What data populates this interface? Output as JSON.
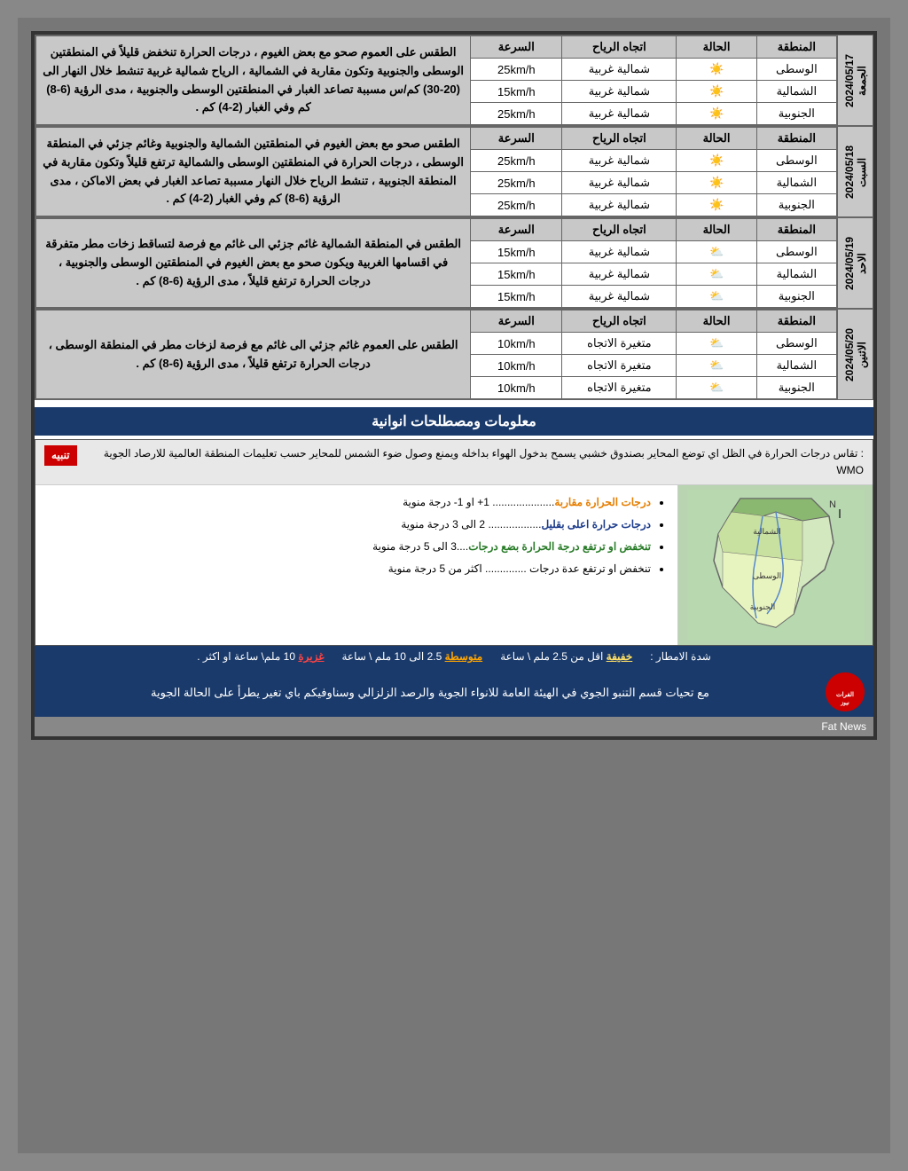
{
  "page": {
    "background": "#777",
    "border_color": "#333"
  },
  "days": [
    {
      "id": "friday",
      "label": "الجمعة\n2024/05/17",
      "description": "الطقس على العموم صحو مع بعض الغيوم ، درجات الحرارة تنخفض قليلاً في المنطقتين الوسطى والجنوبية وتكون مقاربة في الشمالية ، الرياح شمالية غربية تنشط خلال النهار الى (20-30) كم/س مسببة تصاعد الغبار في المنطقتين الوسطى والجنوبية ، مدى الرؤية (6-8) كم وفي الغبار (2-4) كم .",
      "header": {
        "region": "المنطقة",
        "condition": "الحالة",
        "direction": "اتجاه الرياح",
        "speed": "السرعة"
      },
      "rows": [
        {
          "region": "الوسطى",
          "condition": "sun",
          "direction": "شمالية غربية",
          "speed": "25km/h"
        },
        {
          "region": "الشمالية",
          "condition": "sun",
          "direction": "شمالية غربية",
          "speed": "15km/h"
        },
        {
          "region": "الجنوبية",
          "condition": "sun",
          "direction": "شمالية غربية",
          "speed": "25km/h"
        }
      ]
    },
    {
      "id": "saturday",
      "label": "السبت\n2024/05/18",
      "description": "الطقس صحو مع بعض الغيوم في المنطقتين الشمالية والجنوبية وغائم جزئي في المنطقة الوسطى ، درجات الحرارة في المنطقتين الوسطى والشمالية ترتفع قليلاً وتكون مقاربة في المنطقة الجنوبية ، تنشط الرياح خلال النهار مسببة تصاعد الغبار في بعض الاماكن ، مدى الرؤية (6-8) كم وفي الغبار (2-4) كم .",
      "header": {
        "region": "المنطقة",
        "condition": "الحالة",
        "direction": "اتجاه الرياح",
        "speed": "السرعة"
      },
      "rows": [
        {
          "region": "الوسطى",
          "condition": "sun",
          "direction": "شمالية غربية",
          "speed": "25km/h"
        },
        {
          "region": "الشمالية",
          "condition": "sun",
          "direction": "شمالية غربية",
          "speed": "25km/h"
        },
        {
          "region": "الجنوبية",
          "condition": "sun",
          "direction": "شمالية غربية",
          "speed": "25km/h"
        }
      ]
    },
    {
      "id": "sunday",
      "label": "الاحد\n2024/05/19",
      "description": "الطقس في المنطقة الشمالية غائم جزئي الى غائم مع فرصة لتساقط زخات مطر متفرقة في اقسامها الغربية ويكون صحو مع بعض الغيوم في المنطقتين الوسطى والجنوبية ، درجات الحرارة ترتفع قليلاً ، مدى الرؤية (6-8) كم .",
      "header": {
        "region": "المنطقة",
        "condition": "الحالة",
        "direction": "اتجاه الرياح",
        "speed": "السرعة"
      },
      "rows": [
        {
          "region": "الوسطى",
          "condition": "cloud-sun",
          "direction": "شمالية غربية",
          "speed": "15km/h"
        },
        {
          "region": "الشمالية",
          "condition": "cloud-sun",
          "direction": "شمالية غربية",
          "speed": "15km/h"
        },
        {
          "region": "الجنوبية",
          "condition": "cloud-sun",
          "direction": "شمالية غربية",
          "speed": "15km/h"
        }
      ]
    },
    {
      "id": "monday",
      "label": "الاثنين\n2024/05/20",
      "description": "الطقس على العموم غائم جزئي الى غائم مع فرصة لزخات مطر في المنطقة الوسطى ، درجات الحرارة ترتفع قليلاً ، مدى الرؤية (6-8) كم .",
      "header": {
        "region": "المنطقة",
        "condition": "الحالة",
        "direction": "اتجاه الرياح",
        "speed": "السرعة"
      },
      "rows": [
        {
          "region": "الوسطى",
          "condition": "cloud-sun",
          "direction": "متغيرة الاتجاه",
          "speed": "10km/h"
        },
        {
          "region": "الشمالية",
          "condition": "cloud-sun",
          "direction": "متغيرة الاتجاه",
          "speed": "10km/h"
        },
        {
          "region": "الجنوبية",
          "condition": "cloud-sun",
          "direction": "متغيرة الاتجاه",
          "speed": "10km/h"
        }
      ]
    }
  ],
  "info_section": {
    "title": "معلومات ومصطلحات انوانية",
    "notice_tag": "تنبيه",
    "notice_text": ": تقاس درجات الحرارة في الظل اي توضع المحاير بصندوق خشبي يسمح بدخول الهواء بداخله ويمنع وصول ضوء الشمس للمحاير حسب تعليمات المنطقة العالمية للارصاد الجوية WMO",
    "legend_items": [
      {
        "color": "orange",
        "text": "درجات الحرارة مقاربة..................... 1+ او 1- درجة منوية"
      },
      {
        "color": "blue",
        "text": "درجات حرارة اعلى بقليل.................. 2 الى 3 درجة منوية"
      },
      {
        "color": "green",
        "text": "تنخفض او ترتفع درجة الحرارة بضع درجات....3 الى 5 درجة منوية"
      },
      {
        "color": "default",
        "text": "تنخفض او ترتفع عدة درجات .............. اكثر من 5 درجة منوية"
      }
    ]
  },
  "rain_section": {
    "label_light": "خفيفة",
    "label_medium": "متوسطة",
    "label_heavy": "غزيرة",
    "desc_light": "اقل من 2.5 ملم \\ ساعة",
    "desc_medium": "2.5 الى 10 ملم \\ ساعة",
    "desc_heavy": "10 ملم\\ ساعة او اكثر .",
    "prefix": "شدة الامطار :"
  },
  "footer": {
    "text": "مع تحيات قسم التنبو الجوي في الهيئة العامة للانواء الجوية والرصد الزلزالي وسناوفيكم باي تغير يطرأ على الحالة الجوية",
    "logo_text": "الفرات نيوز",
    "bottom_label": "Fat News"
  }
}
